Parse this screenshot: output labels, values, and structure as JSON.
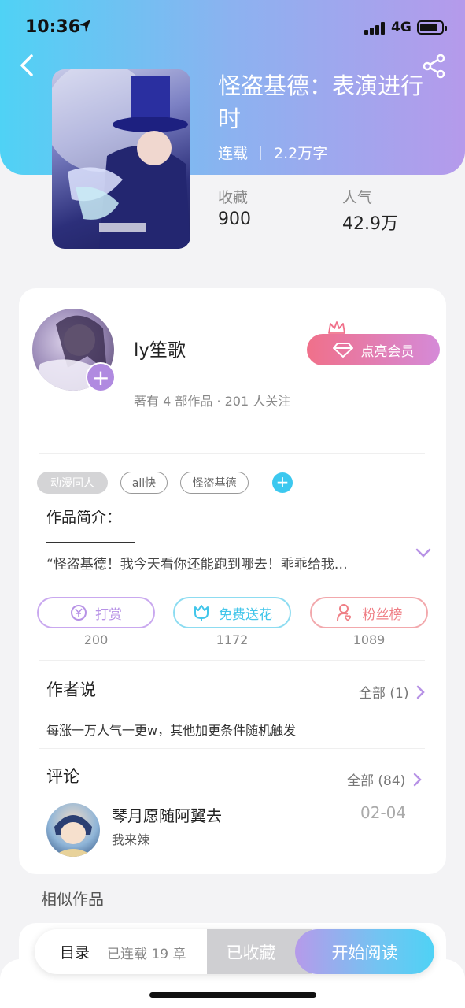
{
  "status_bar": {
    "time": "10:36",
    "network": "4G"
  },
  "book": {
    "title": "怪盗基德：表演进行时",
    "status": "连载",
    "word_count": "2.2万字",
    "stats": [
      {
        "label": "收藏",
        "value": "900"
      },
      {
        "label": "人气",
        "value": "42.9万"
      }
    ]
  },
  "author": {
    "name": "ly笙歌",
    "stats": "著有 4 部作品 · 201 人关注",
    "vip_button": "点亮会员"
  },
  "tags": [
    {
      "label": "动漫同人",
      "style": "filled"
    },
    {
      "label": "all快",
      "style": "outline"
    },
    {
      "label": "怪盗基德",
      "style": "outline"
    }
  ],
  "intro": {
    "heading": "作品简介：",
    "text": "“怪盗基德！我今天看你还能跑到哪去！乖乖给我…"
  },
  "actions": [
    {
      "label": "打赏",
      "count": "200",
      "color": "#b792e6"
    },
    {
      "label": "免费送花",
      "count": "1172",
      "color": "#42c6ea"
    },
    {
      "label": "粉丝榜",
      "count": "1089",
      "color": "#ef7f86"
    }
  ],
  "author_say": {
    "title": "作者说",
    "more": "全部 (1)",
    "text": "每涨一万人气一更w，其他加更条件随机触发"
  },
  "comments": {
    "title": "评论",
    "more": "全部 (84)",
    "items": [
      {
        "name": "琴月愿随阿翼去",
        "date": "02-04",
        "text": "我来辣"
      }
    ]
  },
  "similar": {
    "title": "相似作品"
  },
  "bottom_bar": {
    "toc": "目录",
    "chapters": "已连载 19 章",
    "collected": "已收藏",
    "read": "开始阅读"
  },
  "icons": [
    "back-arrow-icon",
    "share-icon",
    "location-arrow-icon",
    "diamond-icon",
    "crown-icon",
    "plus-icon",
    "yen-coin-icon",
    "flower-icon",
    "fan-user-icon",
    "chevron-right-icon",
    "chevron-down-icon"
  ]
}
